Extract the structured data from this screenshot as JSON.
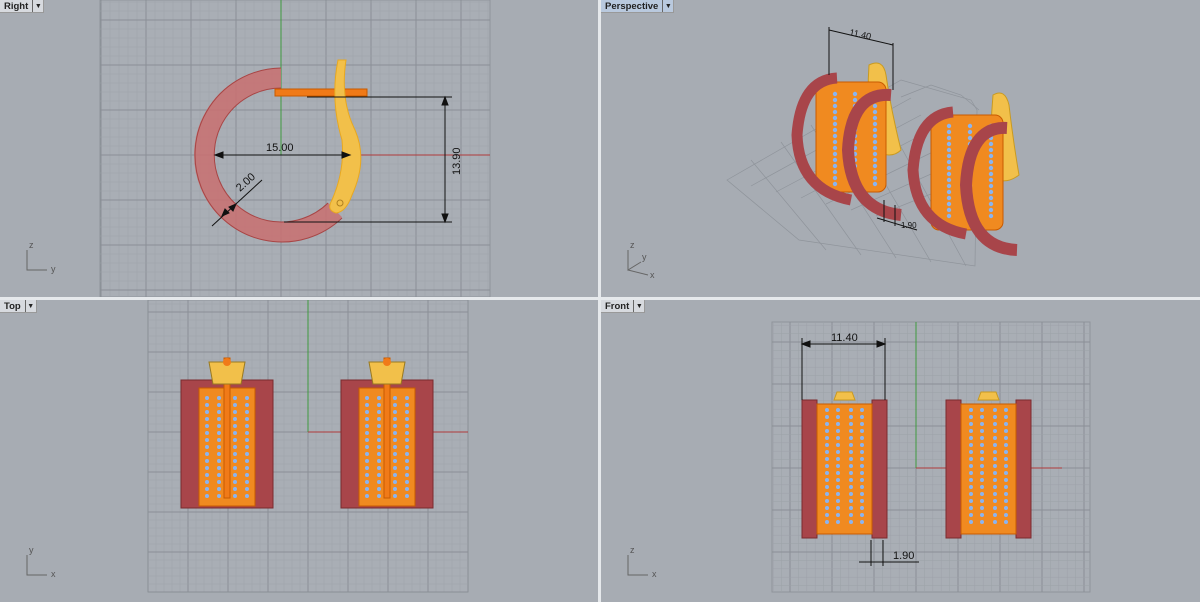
{
  "viewports": {
    "right": {
      "label": "Right",
      "dims": {
        "diameter": "15.00",
        "thickness": "2.00",
        "height": "13.90"
      },
      "axes": {
        "v": "z",
        "h": "y"
      }
    },
    "perspective": {
      "label": "Perspective",
      "dims": {
        "width": "11.40",
        "gap": "1.90"
      },
      "axes": {
        "v": "z",
        "d": "y",
        "h": "x"
      }
    },
    "top": {
      "label": "Top",
      "axes": {
        "v": "y",
        "h": "x"
      }
    },
    "front": {
      "label": "Front",
      "dims": {
        "width": "11.40",
        "gap": "1.90"
      },
      "axes": {
        "v": "z",
        "h": "x"
      }
    }
  },
  "active_viewport": "Perspective",
  "icons": {
    "dropdown": "caret-down-icon"
  },
  "colors": {
    "viewport_bg": "#a7acb3",
    "grid": "#8f949b",
    "x_axis": "#b03a3a",
    "y_axis": "#3f9a3f",
    "metal_rose": "#a8454a",
    "metal_orange": "#f08a20",
    "metal_yellow": "#f2c04a",
    "stones": "#8ab4f0"
  }
}
